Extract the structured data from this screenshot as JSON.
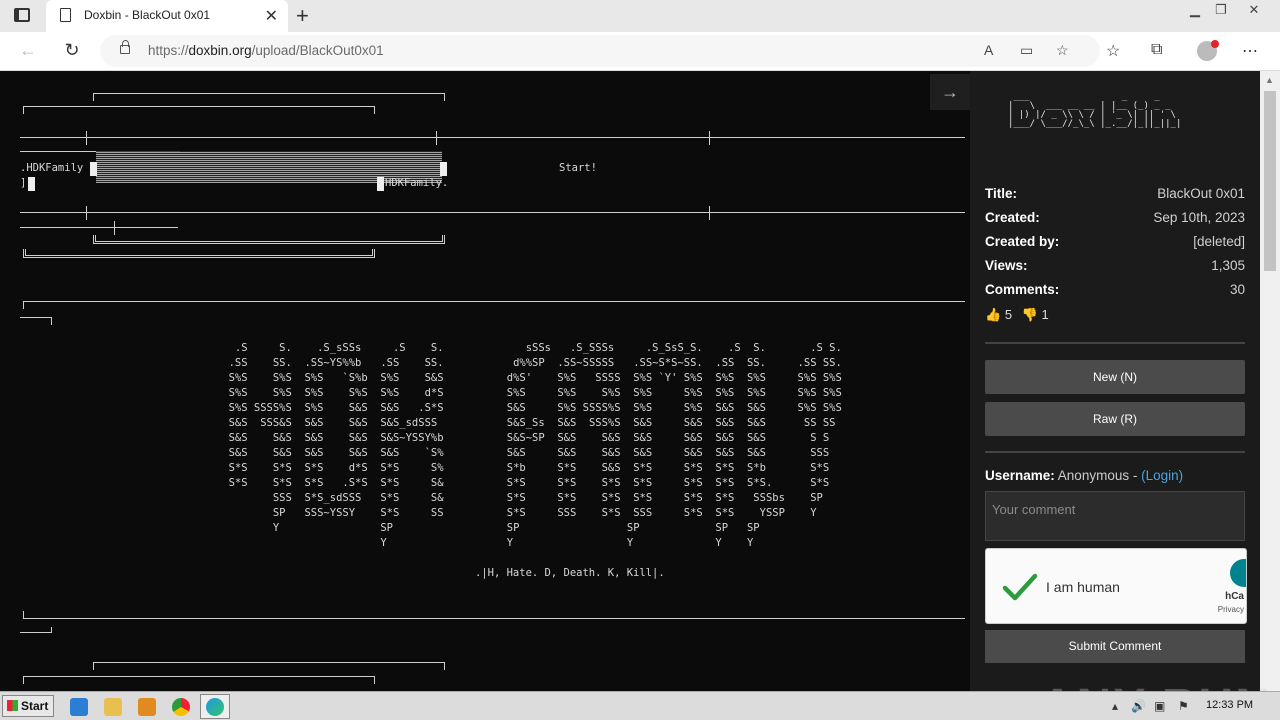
{
  "browser": {
    "tab_title": "Doxbin - BlackOut 0x01",
    "url_prefix": "https://",
    "url_domain": "doxbin.org",
    "url_path": "/upload/BlackOut0x01",
    "new_tab_glyph": "+",
    "close_tab_glyph": "✕"
  },
  "paste": {
    "ascii_lines_1": [
      ".HDKFamily",
      "]"
    ],
    "right_label_1": "HDKFamily.",
    "start_label": "Start!",
    "bigtext": "                                  .S     S.    .S_sSSs     .S    S.             sSSs   .S_SSSs     .S_SsS_S.    .S  S.       .S S.  \n                                 .SS    SS.  .SS~YS%%b   .SS    SS.           d%%SP  .SS~SSSSS   .SS~S*S~SS.  .SS  SS.     .SS SS. \n                                 S%S    S%S  S%S   `S%b  S%S    S&S          d%S'    S%S   SSSS  S%S `Y' S%S  S%S  S%S     S%S S%S \n                                 S%S    S%S  S%S    S%S  S%S    d*S          S%S     S%S    S%S  S%S     S%S  S%S  S%S     S%S S%S \n                                 S%S SSSS%S  S%S    S&S  S&S   .S*S          S&S     S%S SSSS%S  S%S     S%S  S&S  S&S     S%S S%S \n                                 S&S  SSS&S  S&S    S&S  S&S_sdSSS           S&S_Ss  S&S  SSS%S  S&S     S&S  S&S  S&S      SS SS  \n                                 S&S    S&S  S&S    S&S  S&S~YSSY%b          S&S~SP  S&S    S&S  S&S     S&S  S&S  S&S       S S   \n                                 S&S    S&S  S&S    S&S  S&S    `S%          S&S     S&S    S&S  S&S     S&S  S&S  S&S       SSS   \n                                 S*S    S*S  S*S    d*S  S*S     S%          S*b     S*S    S&S  S*S     S*S  S*S  S*b       S*S   \n                                 S*S    S*S  S*S   .S*S  S*S     S&          S*S     S*S    S*S  S*S     S*S  S*S  S*S.      S*S   \n                                        SSS  S*S_sdSSS   S*S     S&          S*S     S*S    S*S  S*S     S*S  S*S   SSSbs    SP    \n                                        SP   SSS~YSSY    S*S     SS          S*S     SSS    S*S  SSS     S*S  S*S    YSSP    Y     \n                                        Y                SP                  SP                 SP            SP   SP                \n                                                         Y                   Y                  Y             Y    Y                 ",
    "tagline": ".|H, Hate. D, Death. K, Kill|."
  },
  "sidebar": {
    "logo_ascii": " ___                 _     _        \n|   \\  ___ __ __ | |__ (_) _ _   \n| |) |/ _ \\\\ \\ / | '_ \\| || ' \\  \n|___/ \\___//_\\_\\ |_.__/|_||_||_| ",
    "meta": [
      {
        "key": "Title:",
        "value": "BlackOut 0x01"
      },
      {
        "key": "Created:",
        "value": "Sep 10th, 2023"
      },
      {
        "key": "Created by:",
        "value": "[deleted]"
      },
      {
        "key": "Views:",
        "value": "1,305"
      },
      {
        "key": "Comments:",
        "value": "30"
      }
    ],
    "likes": "5",
    "dislikes": "1",
    "new_button": "New (N)",
    "raw_button": "Raw (R)",
    "username_label": "Username:",
    "username_value": "Anonymous - ",
    "login_link": "(Login)",
    "comment_placeholder": "Your comment",
    "captcha_label": "I am human",
    "captcha_brand": "hCa",
    "captcha_privacy": "Privacy",
    "submit_button": "Submit Comment"
  },
  "taskbar": {
    "start_label": "Start",
    "clock": "12:33 PM"
  },
  "watermark": "ANY RUN",
  "colors": {
    "page_bg": "#0b0b0b",
    "sidebar_bg": "#1b1b1b",
    "button_bg": "#4b4b4b",
    "link": "#4aa3df",
    "check_green": "#2e9b3e"
  }
}
